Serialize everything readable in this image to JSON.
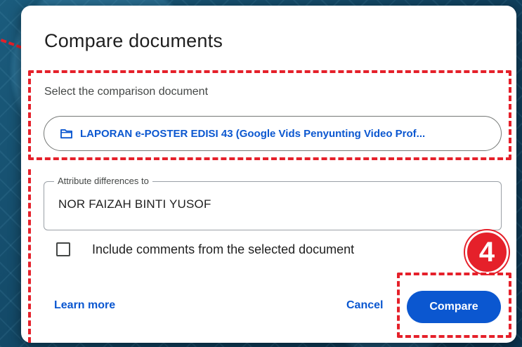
{
  "dialog": {
    "title": "Compare documents",
    "comparison_label": "Select the comparison document",
    "selected_document": "LAPORAN e-POSTER EDISI 43 (Google Vids Penyunting Video Prof...",
    "attribute_label": "Attribute differences to",
    "attribute_value": "NOR FAIZAH BINTI YUSOF",
    "include_comments_label": "Include comments from the selected document",
    "include_comments_checked": false,
    "learn_more_label": "Learn more",
    "cancel_label": "Cancel",
    "compare_label": "Compare"
  },
  "annotation": {
    "step_number": "4",
    "highlight_color": "#e5202a"
  },
  "colors": {
    "accent": "#0b57d0",
    "title_text": "#1f1f1f",
    "secondary_text": "#444746"
  },
  "icons": {
    "document_picker": "folder-icon"
  }
}
